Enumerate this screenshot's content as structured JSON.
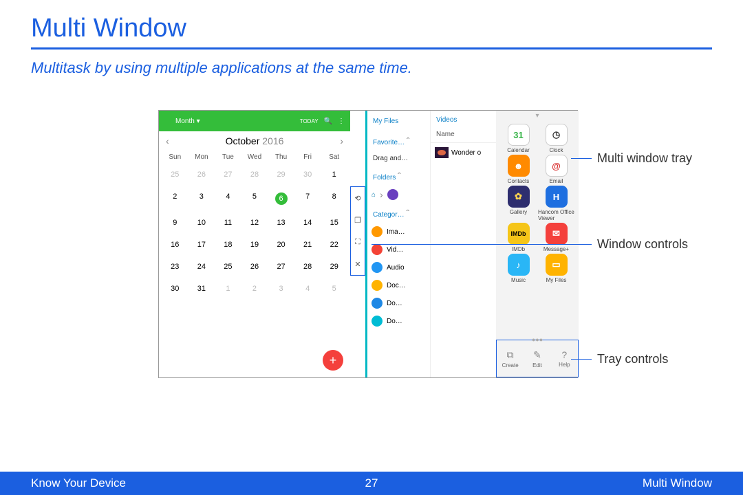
{
  "page": {
    "title": "Multi Window",
    "subtitle": "Multitask by using multiple applications at the same time."
  },
  "callouts": {
    "tray": "Multi window tray",
    "controls": "Window controls",
    "tray_controls": "Tray controls"
  },
  "calendar": {
    "mode": "Month",
    "today_label": "TODAY",
    "month": "October",
    "year": "2016",
    "days_of_week": [
      "Sun",
      "Mon",
      "Tue",
      "Wed",
      "Thu",
      "Fri",
      "Sat"
    ],
    "leading": [
      "25",
      "26",
      "27",
      "28",
      "29",
      "30"
    ],
    "days": [
      "1",
      "2",
      "3",
      "4",
      "5",
      "6",
      "7",
      "8",
      "9",
      "10",
      "11",
      "12",
      "13",
      "14",
      "15",
      "16",
      "17",
      "18",
      "19",
      "20",
      "21",
      "22",
      "23",
      "24",
      "25",
      "26",
      "27",
      "28",
      "29",
      "30",
      "31"
    ],
    "trailing": [
      "1",
      "2",
      "3",
      "4",
      "5"
    ],
    "today": "6"
  },
  "files": {
    "title": "My Files",
    "left": {
      "favorite": "Favorite…",
      "drag": "Drag and…",
      "folders": "Folders",
      "category": "Categor…",
      "items": [
        "Ima…",
        "Vid…",
        "Audio",
        "Doc…",
        "Do…",
        "Do…"
      ]
    },
    "right": {
      "header": "Videos",
      "name": "Name",
      "file": "Wonder o"
    }
  },
  "tray": {
    "apps": [
      {
        "label": "Calendar",
        "bg": "#ffffff",
        "fg": "#39b54a",
        "txt": "31",
        "border": "#ccc"
      },
      {
        "label": "Clock",
        "bg": "#ffffff",
        "fg": "#333",
        "txt": "◷",
        "border": "#ccc"
      },
      {
        "label": "Contacts",
        "bg": "#ff8a00",
        "fg": "#fff",
        "txt": "☻"
      },
      {
        "label": "Email",
        "bg": "#ffffff",
        "fg": "#d82b2b",
        "txt": "@",
        "border": "#ccc"
      },
      {
        "label": "Gallery",
        "bg": "#2e2e6f",
        "fg": "#ffd54f",
        "txt": "✿"
      },
      {
        "label": "Hancom Office Viewer",
        "bg": "#1e6fe0",
        "fg": "#fff",
        "txt": "H"
      },
      {
        "label": "IMDb",
        "bg": "#f5c518",
        "fg": "#000",
        "txt": "IMDb",
        "fs": "9px"
      },
      {
        "label": "Message+",
        "bg": "#f4403c",
        "fg": "#fff",
        "txt": "✉"
      },
      {
        "label": "Music",
        "bg": "#29b6f6",
        "fg": "#fff",
        "txt": "♪"
      },
      {
        "label": "My Files",
        "bg": "#ffb300",
        "fg": "#fff",
        "txt": "▭"
      }
    ],
    "controls": [
      {
        "label": "Create",
        "icon": "⧉"
      },
      {
        "label": "Edit",
        "icon": "✎"
      },
      {
        "label": "Help",
        "icon": "?"
      }
    ]
  },
  "footer": {
    "left": "Know Your Device",
    "page": "27",
    "right": "Multi Window"
  }
}
